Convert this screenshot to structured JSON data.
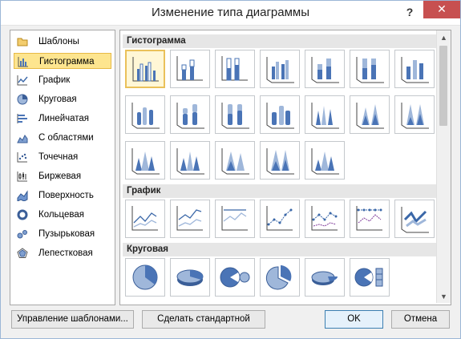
{
  "window": {
    "title": "Изменение типа диаграммы",
    "help": "?",
    "close": "✕"
  },
  "sidebar": {
    "items": [
      {
        "label": "Шаблоны",
        "icon": "folder-icon"
      },
      {
        "label": "Гистограмма",
        "icon": "column-chart-icon"
      },
      {
        "label": "График",
        "icon": "line-chart-icon"
      },
      {
        "label": "Круговая",
        "icon": "pie-chart-icon"
      },
      {
        "label": "Линейчатая",
        "icon": "bar-chart-icon"
      },
      {
        "label": "С областями",
        "icon": "area-chart-icon"
      },
      {
        "label": "Точечная",
        "icon": "scatter-chart-icon"
      },
      {
        "label": "Биржевая",
        "icon": "stock-chart-icon"
      },
      {
        "label": "Поверхность",
        "icon": "surface-chart-icon"
      },
      {
        "label": "Кольцевая",
        "icon": "doughnut-chart-icon"
      },
      {
        "label": "Пузырьковая",
        "icon": "bubble-chart-icon"
      },
      {
        "label": "Лепестковая",
        "icon": "radar-chart-icon"
      }
    ],
    "selected": "Гистограмма"
  },
  "sections": [
    {
      "title": "Гистограмма"
    },
    {
      "title": "График"
    },
    {
      "title": "Круговая"
    }
  ],
  "buttons": {
    "manage_templates": "Управление шаблонами...",
    "set_default": "Сделать стандартной",
    "ok": "OK",
    "cancel": "Отмена"
  }
}
